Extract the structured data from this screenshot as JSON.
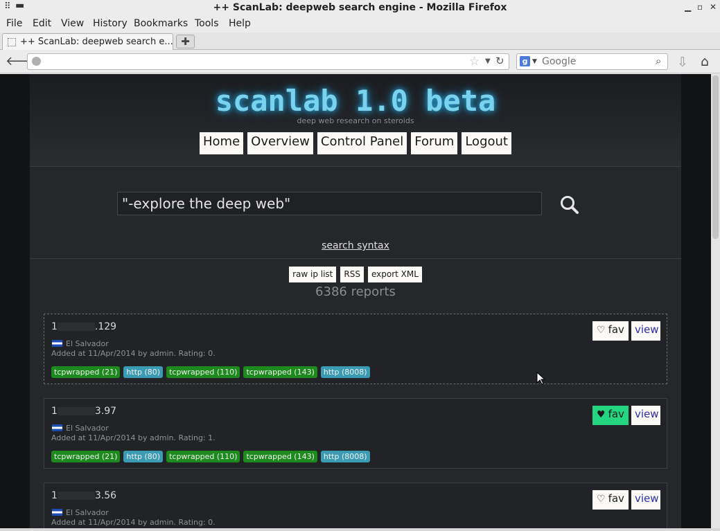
{
  "window": {
    "title": "++ ScanLab: deepweb search engine - Mozilla Firefox"
  },
  "menu": {
    "file": "File",
    "edit": "Edit",
    "view": "View",
    "history": "History",
    "bookmarks": "Bookmarks",
    "tools": "Tools",
    "help": "Help"
  },
  "tab": {
    "label": "++ ScanLab: deepweb search e..."
  },
  "toolbar": {
    "url": "",
    "search_placeholder": "Google",
    "search_engine": "Google"
  },
  "site": {
    "logo": "scanlab 1.0 beta",
    "tagline": "deep web research on steroids",
    "nav": [
      "Home",
      "Overview",
      "Control Panel",
      "Forum",
      "Logout"
    ],
    "query": "\"-explore the deep web\"",
    "search_syntax": "search syntax",
    "actions": [
      "raw ip list",
      "RSS",
      "export XML"
    ],
    "report_count": "6386 reports"
  },
  "results": [
    {
      "ip_start": "1",
      "ip_end": ".129",
      "country": "El Salvador",
      "added": "Added at 11/Apr/2014 by admin. Rating: 0.",
      "fav_label": "fav",
      "fav_active": false,
      "view_label": "view",
      "tags": [
        {
          "label": "tcpwrapped (21)",
          "color": "green"
        },
        {
          "label": "http (80)",
          "color": "teal"
        },
        {
          "label": "tcpwrapped (110)",
          "color": "green"
        },
        {
          "label": "tcpwrapped (143)",
          "color": "green"
        },
        {
          "label": "http (8008)",
          "color": "teal"
        }
      ]
    },
    {
      "ip_start": "1",
      "ip_end": "3.97",
      "country": "El Salvador",
      "added": "Added at 11/Apr/2014 by admin. Rating: 1.",
      "fav_label": "fav",
      "fav_active": true,
      "view_label": "view",
      "tags": [
        {
          "label": "tcpwrapped (21)",
          "color": "green"
        },
        {
          "label": "http (80)",
          "color": "teal"
        },
        {
          "label": "tcpwrapped (110)",
          "color": "green"
        },
        {
          "label": "tcpwrapped (143)",
          "color": "green"
        },
        {
          "label": "http (8008)",
          "color": "teal"
        }
      ]
    },
    {
      "ip_start": "1",
      "ip_end": "3.56",
      "country": "El Salvador",
      "added": "Added at 11/Apr/2014 by admin. Rating: 0.",
      "fav_label": "fav",
      "fav_active": false,
      "view_label": "view",
      "tags": []
    }
  ],
  "colors": {
    "logo": "#7ad3ee",
    "tag_green": "#1d8a1d",
    "tag_teal": "#3a9bb3",
    "fav_active": "#25d680",
    "view_link": "#2a2ca6"
  }
}
